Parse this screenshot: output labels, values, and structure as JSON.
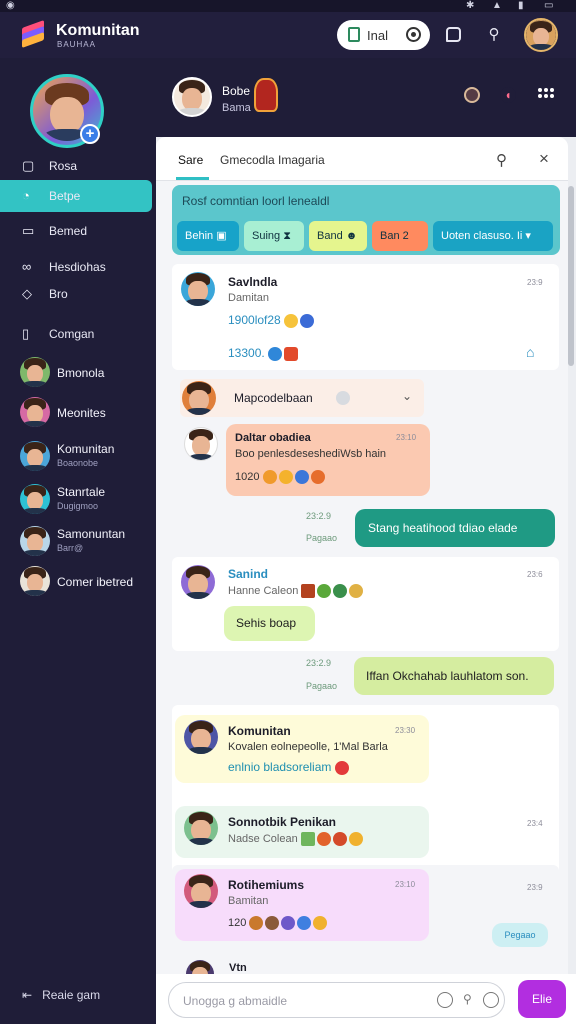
{
  "app": {
    "title": "Komunitan",
    "subtitle": "BAUHAA"
  },
  "topbar": {
    "search_label": "Inal"
  },
  "sidebar": {
    "nav": [
      {
        "label": "Rosa",
        "icon": "chat-bubble-icon"
      },
      {
        "label": "Betpe",
        "icon": "clock-icon",
        "active": true
      },
      {
        "label": "Bemed",
        "icon": "book-icon"
      },
      {
        "label": "Hesdiohas",
        "icon": "link-icon"
      },
      {
        "label": "Bro",
        "icon": "shield-icon"
      },
      {
        "label": "Comgan",
        "icon": "folder-icon"
      }
    ],
    "contacts": [
      {
        "name": "Bmonola",
        "sub": ""
      },
      {
        "name": "Meonites",
        "sub": ""
      },
      {
        "name": "Komunitan",
        "sub": "Boaonobe"
      },
      {
        "name": "Stanrtale",
        "sub": "Dugigmoo"
      },
      {
        "name": "Samonuntan",
        "sub": "Barr@"
      },
      {
        "name": "Comer ibetred",
        "sub": ""
      }
    ],
    "bottom_label": "Reaie gam"
  },
  "chat_header": {
    "name": "Bobe",
    "sub": "Bama"
  },
  "tabs": [
    {
      "label": "Sare",
      "active": true
    },
    {
      "label": "Gmecodla Imagaria",
      "active": false
    }
  ],
  "filter": {
    "title": "Rosf comntian loorl lenealdl",
    "chips": [
      {
        "label": "Behin",
        "color": "#17a3c9"
      },
      {
        "label": "Suing",
        "color": "#a8efd3"
      },
      {
        "label": "Band",
        "color": "#e5f58e"
      },
      {
        "label": "Ban 2",
        "color": "#ff8a5f"
      },
      {
        "label": "Uoten clasuso. Ii",
        "color": "#1aa3c4"
      }
    ]
  },
  "messages": [
    {
      "name": "Savlndla",
      "sub": "Damitan",
      "time": "23:9",
      "line1": "1900lof28",
      "line2": "13300."
    },
    {
      "name": "Mapcodelbaan",
      "sub": "",
      "time": ""
    },
    {
      "name": "Daltar obadiea",
      "sub": "Boo penlesdeseshediWsb hain",
      "time": "23:10",
      "extra": "1020"
    },
    {
      "text": "Stang heatihood tdiao elade",
      "time": "23:2.9",
      "status": "Pagaao"
    },
    {
      "name": "Sanind",
      "sub": "Hanne Caleon",
      "time": "23:6",
      "bubble": "Sehis boap"
    },
    {
      "text": "Iffan Okchahab lauhlatom son.",
      "time": "23:2.9",
      "status": "Pagaao"
    },
    {
      "name": "Komunitan",
      "sub": "Kovalen eolnepeolle, 1'Mal Barla",
      "link": "enlnio bladsoreliam",
      "time": "23:30"
    },
    {
      "name": "Sonnotbik Penikan",
      "sub": "Nadse Colean",
      "time": "23:4"
    },
    {
      "name": "Rotihemiums",
      "sub": "Bamitan",
      "extra": "120",
      "time": "23:10",
      "time2": "23:9",
      "tag": "Pegaao"
    },
    {
      "name": "Vtn",
      "sub": "",
      "time": ""
    }
  ],
  "composer": {
    "placeholder": "Unogga g abmaidle",
    "send_label": "Elie"
  },
  "colors": {
    "accent": "#33c3c4",
    "send": "#b22ee0",
    "sidebar": "#1f1d38"
  }
}
